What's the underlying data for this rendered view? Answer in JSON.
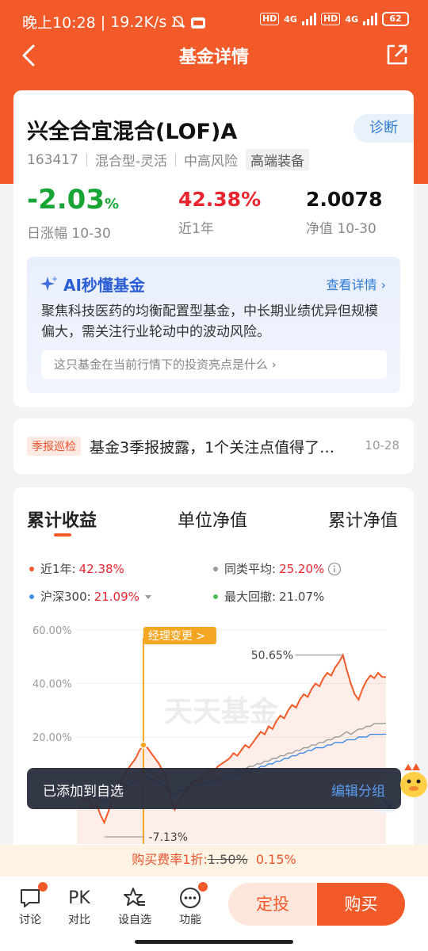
{
  "status_bar": {
    "time": "晚上10:28",
    "speed": "19.2K/s",
    "net1": "HD 4G",
    "net2": "HD 4G",
    "battery": "62"
  },
  "nav": {
    "title": "基金详情"
  },
  "fund": {
    "name": "兴全合宜混合(LOF)A",
    "code": "163417",
    "type": "混合型-灵活",
    "risk": "中高风险",
    "tag": "高端装备",
    "diagnose": "诊断",
    "daily_change": "-2.03",
    "daily_change_unit": "%",
    "daily_label": "日涨幅 10-30",
    "year_return": "42.38%",
    "year_label": "近1年",
    "nav_value": "2.0078",
    "nav_label": "净值 10-30"
  },
  "ai": {
    "title": "AI秒懂基金",
    "more": "查看详情",
    "desc": "聚焦科技医药的均衡配置型基金，中长期业绩优异但规模偏大，需关注行业轮动中的波动风险。",
    "question": "这只基金在当前行情下的投资亮点是什么"
  },
  "news": {
    "tag": "季报巡检",
    "text": "基金3季报披露，1个关注点值得了…",
    "date": "10-28"
  },
  "chart_tabs": [
    "累计收益",
    "单位净值",
    "累计净值"
  ],
  "legend": {
    "fund_label": "近1年:",
    "fund_value": "42.38%",
    "peer_label": "同类平均:",
    "peer_value": "25.20%",
    "index_label": "沪深300:",
    "index_value": "21.09%",
    "drawdown_label": "最大回撤:",
    "drawdown_value": "21.07%"
  },
  "chart_data": {
    "type": "line",
    "yticks": [
      "60.00%",
      "40.00%",
      "20.00%"
    ],
    "ylim": [
      -20,
      60
    ],
    "annotations": {
      "manager_change": "经理变更 >",
      "max": "50.65%",
      "min": "-7.13%"
    },
    "watermark": "天天基金",
    "x": [
      0,
      1,
      2,
      3,
      4,
      5,
      6,
      7,
      8,
      9,
      10,
      11,
      12,
      13,
      14,
      15,
      16,
      17,
      18,
      19,
      20,
      21,
      22,
      23,
      24,
      25,
      26,
      27,
      28,
      29,
      30,
      31,
      32,
      33,
      34,
      35,
      36,
      37,
      38,
      39,
      40,
      41,
      42,
      43,
      44,
      45,
      46,
      47,
      48,
      49,
      50,
      51,
      52,
      53,
      54,
      55,
      56,
      57,
      58,
      59,
      60,
      61,
      62,
      63,
      64,
      65,
      66,
      67,
      68,
      69,
      70,
      71,
      72,
      73,
      74,
      75,
      76,
      77,
      78,
      79
    ],
    "series": [
      {
        "name": "近1年",
        "color": "#f25a2a",
        "values": [
          0,
          -2,
          -4,
          -3,
          -6,
          -5,
          -9,
          -12,
          -8,
          -4,
          0,
          3,
          5,
          8,
          10,
          12,
          15,
          17,
          16,
          14,
          12,
          10,
          7,
          4,
          -3,
          -7.13,
          -4,
          -2,
          0,
          2,
          4,
          3,
          5,
          6,
          8,
          7,
          9,
          10,
          11,
          12,
          14,
          13,
          15,
          17,
          16,
          18,
          20,
          22,
          21,
          24,
          23,
          26,
          28,
          27,
          30,
          32,
          31,
          34,
          36,
          35,
          38,
          40,
          39,
          42,
          44,
          43,
          46,
          48,
          50.65,
          45,
          40,
          36,
          34,
          38,
          41,
          43,
          42,
          44,
          42.5,
          42.38
        ]
      },
      {
        "name": "同类平均",
        "color": "#9a9a9a",
        "values": [
          0,
          -1,
          -2,
          -2,
          -3,
          -3,
          -4,
          -5,
          -4,
          -2,
          0,
          1,
          2,
          4,
          5,
          6,
          7,
          8,
          8,
          7,
          6,
          5,
          4,
          2,
          -1,
          -2,
          -1,
          0,
          1,
          2,
          2,
          2,
          3,
          3,
          4,
          4,
          5,
          5,
          6,
          6,
          7,
          7,
          8,
          8,
          9,
          9,
          10,
          10,
          11,
          11,
          12,
          12,
          13,
          13,
          14,
          14,
          15,
          15,
          16,
          16,
          17,
          17,
          18,
          18,
          19,
          19,
          20,
          20,
          21,
          22,
          21,
          22,
          23,
          23,
          24,
          24,
          25,
          25,
          25,
          25.2
        ]
      },
      {
        "name": "沪深300",
        "color": "#3f8de8",
        "values": [
          0,
          -1,
          -1,
          -2,
          -2,
          -3,
          -3,
          -4,
          -3,
          -2,
          -1,
          0,
          1,
          2,
          3,
          4,
          4,
          5,
          5,
          4,
          4,
          3,
          2,
          1,
          -1,
          -1,
          0,
          0,
          1,
          1,
          2,
          2,
          2,
          3,
          3,
          3,
          4,
          4,
          5,
          5,
          5,
          6,
          6,
          7,
          7,
          8,
          8,
          9,
          9,
          10,
          10,
          11,
          11,
          12,
          12,
          13,
          13,
          14,
          14,
          15,
          15,
          16,
          16,
          16,
          17,
          17,
          18,
          18,
          18,
          19,
          19,
          19,
          20,
          20,
          20,
          21,
          21,
          21,
          21,
          21.09
        ]
      }
    ]
  },
  "toast": {
    "text": "已添加到自选",
    "action": "编辑分组"
  },
  "fee": {
    "prefix": "购买费率1折:",
    "old": "1.50%",
    "new": "0.15%"
  },
  "bottom_nav": {
    "discuss": "讨论",
    "pk": "PK",
    "compare": "对比",
    "watch": "设自选",
    "func": "功能",
    "dingtou": "定投",
    "buy": "购买"
  },
  "colors": {
    "brand": "#f25a2a",
    "up": "#e8242f",
    "down": "#19a436"
  }
}
